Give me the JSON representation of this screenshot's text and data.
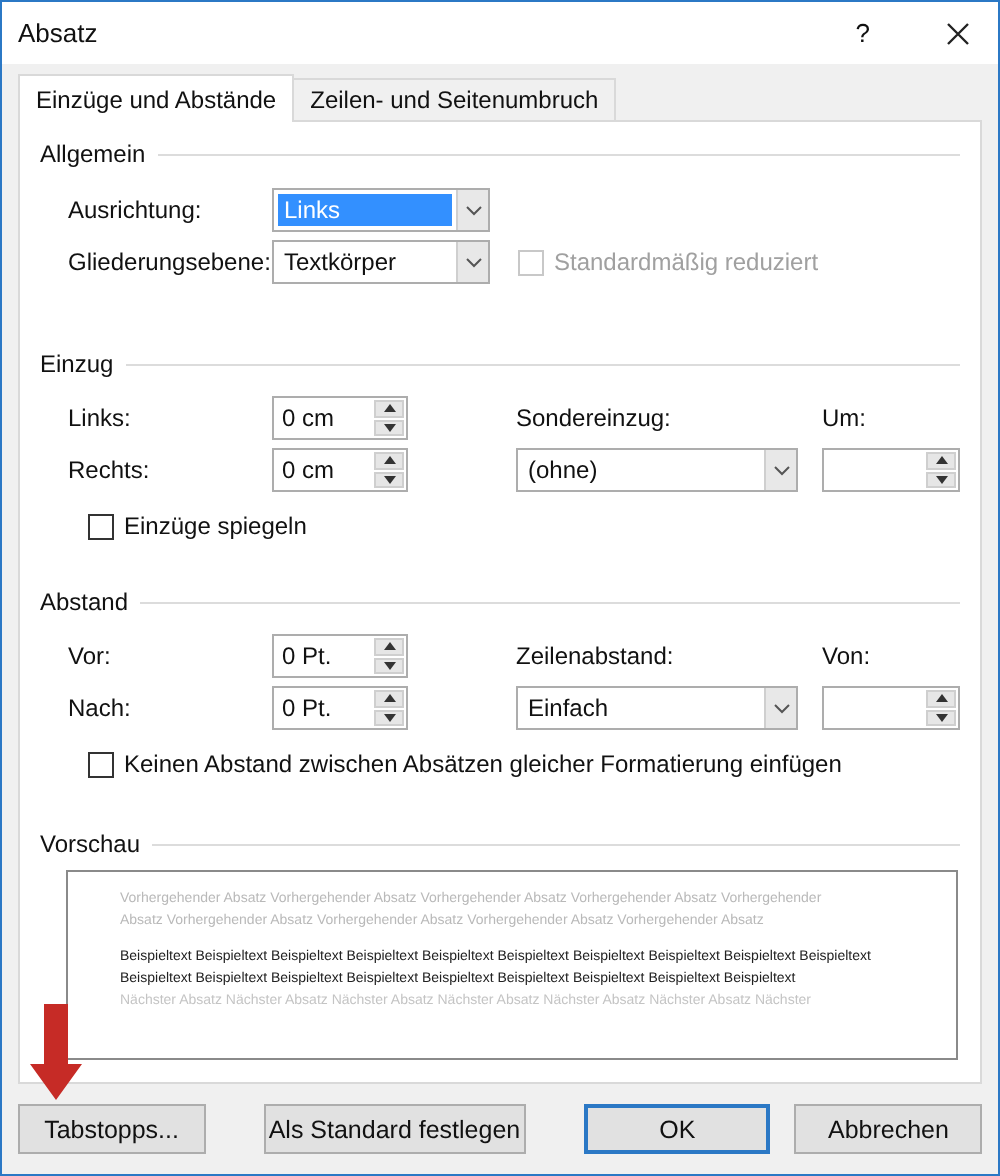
{
  "window": {
    "title": "Absatz",
    "help": "?"
  },
  "tabs": [
    {
      "label": "Einzüge und Abstände",
      "selected": true
    },
    {
      "label": "Zeilen- und Seitenumbruch",
      "selected": false
    }
  ],
  "general": {
    "title": "Allgemein",
    "alignment": {
      "label": "Ausrichtung:",
      "value": "Links",
      "focused": true
    },
    "outline_level": {
      "label": "Gliederungsebene:",
      "value": "Textkörper",
      "focused": false
    },
    "collapsed": {
      "label": "Standardmäßig reduziert",
      "checked": false,
      "disabled": true
    }
  },
  "indent": {
    "title": "Einzug",
    "left": {
      "label": "Links:",
      "value": "0 cm"
    },
    "right": {
      "label": "Rechts:",
      "value": "0 cm"
    },
    "special": {
      "label": "Sondereinzug:",
      "value": "(ohne)",
      "focused": false
    },
    "by": {
      "label": "Um:"
    },
    "mirror": {
      "label": "Einzüge spiegeln",
      "checked": false,
      "disabled": false
    }
  },
  "spacing": {
    "title": "Abstand",
    "before": {
      "label": "Vor:",
      "value": "0 Pt."
    },
    "after": {
      "label": "Nach:",
      "value": "0 Pt."
    },
    "line_spacing": {
      "label": "Zeilenabstand:",
      "value": "Einfach",
      "focused": false
    },
    "at": {
      "label": "Von:"
    },
    "no_space": {
      "label": "Keinen Abstand zwischen Absätzen gleicher Formatierung einfügen",
      "checked": false,
      "disabled": false
    }
  },
  "preview": {
    "title": "Vorschau",
    "paragraphs": [
      {
        "kind": "previous",
        "text": "Vorhergehender Absatz Vorhergehender Absatz Vorhergehender Absatz Vorhergehender Absatz Vorhergehender Absatz Vorhergehender Absatz Vorhergehender Absatz Vorhergehender Absatz Vorhergehender Absatz"
      },
      {
        "kind": "sample",
        "text": "Beispieltext Beispieltext Beispieltext Beispieltext Beispieltext Beispieltext Beispieltext Beispieltext Beispieltext Beispieltext Beispieltext Beispieltext Beispieltext Beispieltext Beispieltext Beispieltext Beispieltext Beispieltext Beispieltext"
      },
      {
        "kind": "next",
        "text": "Nächster Absatz Nächster Absatz Nächster Absatz Nächster Absatz Nächster Absatz Nächster Absatz Nächster"
      }
    ]
  },
  "buttons": [
    {
      "label": "Tabstopps...",
      "default": false
    },
    {
      "label": "Als Standard festlegen",
      "default": false
    },
    {
      "label": "OK",
      "default": true
    },
    {
      "label": "Abbrechen",
      "default": false
    }
  ]
}
